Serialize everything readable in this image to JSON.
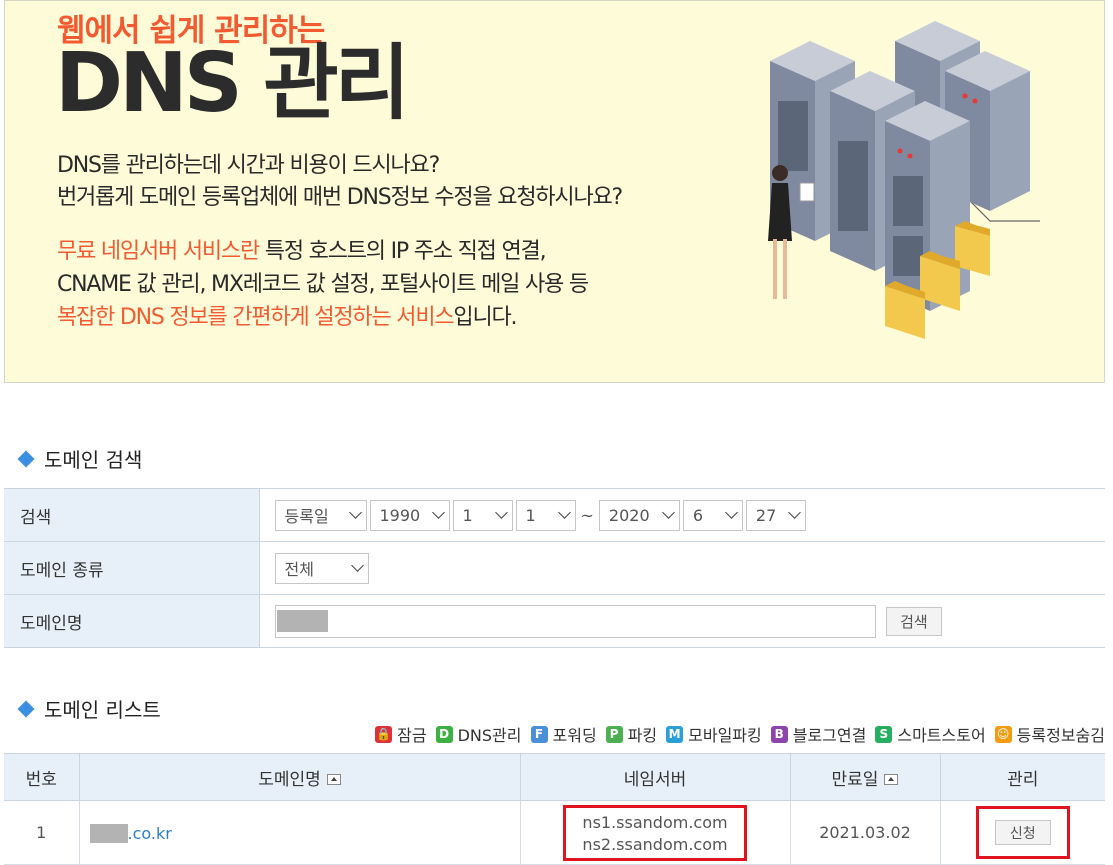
{
  "banner": {
    "subtitle": "웹에서 쉽게 관리하는",
    "title": "DNS 관리",
    "line1": "DNS를 관리하는데 시간과 비용이 드시나요?",
    "line2": "번거롭게 도메인 등록업체에 매번 DNS정보 수정을 요청하시나요?",
    "line3_highlight": "무료 네임서버 서비스란",
    "line3_rest": " 특정 호스트의 IP 주소 직접 연결,",
    "line4": "CNAME 값 관리, MX레코드 값 설정, 포털사이트 메일 사용 등",
    "line5_highlight": "복잡한 DNS 정보를 간편하게 설정하는 서비스",
    "line5_rest": "입니다."
  },
  "search_section": {
    "title": "도메인 검색",
    "row_search_label": "검색",
    "row_type_label": "도메인 종류",
    "row_name_label": "도메인명",
    "date_field": "등록일",
    "from_year": "1990",
    "from_month": "1",
    "from_day": "1",
    "range_separator": "~",
    "to_year": "2020",
    "to_month": "6",
    "to_day": "27",
    "domain_type": "전체",
    "search_button": "검색"
  },
  "list_section": {
    "title": "도메인 리스트",
    "legend": [
      {
        "icon": "lock-icon",
        "letter": "🔒",
        "color": "#e0313a",
        "label": "잠금"
      },
      {
        "icon": "dns-icon",
        "letter": "D",
        "color": "#3cb043",
        "label": "DNS관리"
      },
      {
        "icon": "forwarding-icon",
        "letter": "F",
        "color": "#4a90d9",
        "label": "포워딩"
      },
      {
        "icon": "parking-icon",
        "letter": "P",
        "color": "#4caf50",
        "label": "파킹"
      },
      {
        "icon": "mobile-parking-icon",
        "letter": "M",
        "color": "#2b9fd8",
        "label": "모바일파킹"
      },
      {
        "icon": "blog-icon",
        "letter": "B",
        "color": "#8e44ad",
        "label": "블로그연결"
      },
      {
        "icon": "smartstore-icon",
        "letter": "S",
        "color": "#27ae60",
        "label": "스마트스토어"
      },
      {
        "icon": "privacy-icon",
        "letter": "☺",
        "color": "#f39c12",
        "label": "등록정보숨김"
      }
    ],
    "columns": {
      "number": "번호",
      "domain": "도메인명",
      "nameserver": "네임서버",
      "expiry": "만료일",
      "manage": "관리"
    },
    "rows": [
      {
        "number": "1",
        "domain_suffix": ".co.kr",
        "ns1": "ns1.ssandom.com",
        "ns2": "ns2.ssandom.com",
        "expiry": "2021.03.02",
        "action": "신청"
      }
    ]
  }
}
